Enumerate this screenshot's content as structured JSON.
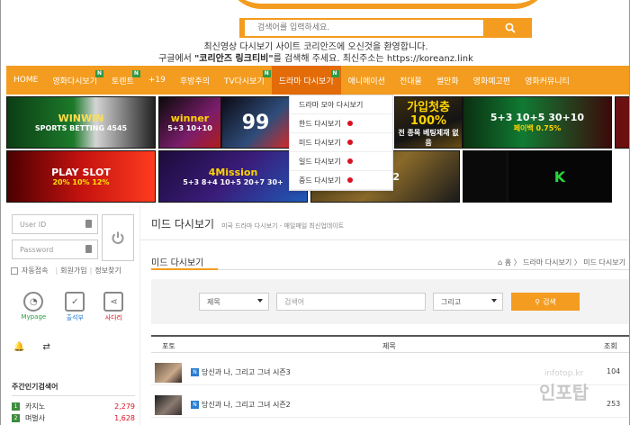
{
  "header": {
    "search_placeholder": "검색어를 입력하세요.",
    "welcome_line1": "최신영상 다시보기 사이트 코리안즈에 오신것을 환영합니다.",
    "welcome_line2_prefix": "구글에서 ",
    "welcome_line2_bold": "\"코리안즈 링크티비\"",
    "welcome_line2_suffix": "를 검색해 주세요. 최신주소는 https://koreanz.link"
  },
  "nav": {
    "items": [
      {
        "label": "HOME",
        "badge": ""
      },
      {
        "label": "영화다시보기",
        "badge": "N"
      },
      {
        "label": "토렌트",
        "badge": "N"
      },
      {
        "label": "+19",
        "badge": ""
      },
      {
        "label": "후방주의",
        "badge": ""
      },
      {
        "label": "TV다시보기",
        "badge": "N"
      },
      {
        "label": "드라마 다시보기",
        "badge": "N"
      },
      {
        "label": "애니메이션",
        "badge": ""
      },
      {
        "label": "전대물",
        "badge": ""
      },
      {
        "label": "썰만화",
        "badge": ""
      },
      {
        "label": "영화예고편",
        "badge": ""
      },
      {
        "label": "영화커뮤니티",
        "badge": ""
      }
    ]
  },
  "dropdown": {
    "items": [
      "드라마 모아 다시보기",
      "한드 다시보기",
      "미드 다시보기",
      "일드 다시보기",
      "중드 다시보기"
    ]
  },
  "banners": [
    {
      "line1": "WINWIN",
      "line2": "SPORTS BETTING 4545"
    },
    {
      "line1": "winner",
      "line2": "5+3 10+10"
    },
    {
      "line1": "99",
      "line2": ""
    },
    {
      "line1": "가입첫충 100%",
      "line2": "전 종목 베팅제재 없음"
    },
    {
      "line1": "5+3 10+5 30+10",
      "line2": "페이백 0.75%"
    },
    {
      "line1": "PLAY SLOT",
      "line2": "20% 10% 12%"
    },
    {
      "line1": "4Mission",
      "line2": "5+3 8+4 10+5 20+7 30+"
    },
    {
      "line1": "+892",
      "line2": ""
    },
    {
      "line1": "",
      "line2": ""
    },
    {
      "line1": "K",
      "line2": ""
    }
  ],
  "sidebar": {
    "user_id_placeholder": "User ID",
    "password_placeholder": "Password",
    "auto_login": "자동접속",
    "join": "회원가입",
    "find": "정보찾기",
    "icons": [
      {
        "label": "Mypage",
        "color": "#2e9a44"
      },
      {
        "label": "출석부",
        "color": "#2a7dd1"
      },
      {
        "label": "사다리",
        "color": "#d9121f"
      }
    ],
    "popular_title": "주간인기검색어",
    "popular": [
      {
        "rank": "1",
        "term": "카지노",
        "count": "2,279"
      },
      {
        "rank": "2",
        "term": "며벌사",
        "count": "1,628"
      }
    ]
  },
  "main": {
    "page_title": "미드 다시보기",
    "page_subtitle": "미국 드라마 다시보기 - 매일매일 최신업데이트",
    "board_title": "미드 다시보기",
    "breadcrumb": "⌂ 홈  〉 드라마 다시보기  〉 미드 다시보기",
    "search": {
      "field_select": "제목",
      "keyword_placeholder": "검색어",
      "operator_select": "그리고",
      "button": "검색"
    },
    "table": {
      "col_photo": "포토",
      "col_title": "제목",
      "col_views": "조회",
      "rows": [
        {
          "badge": "N",
          "title": "당신과 나, 그리고 그녀 시즌3",
          "views": "104"
        },
        {
          "badge": "N",
          "title": "당신과 나, 그리고 그녀 시즌2",
          "views": "253"
        }
      ]
    }
  },
  "watermark": {
    "small": "infotop.kr",
    "big": "인포탑"
  },
  "colors": {
    "accent": "#f39c1f",
    "nav_active": "#e36c09",
    "badge_green": "#2e9a44"
  }
}
